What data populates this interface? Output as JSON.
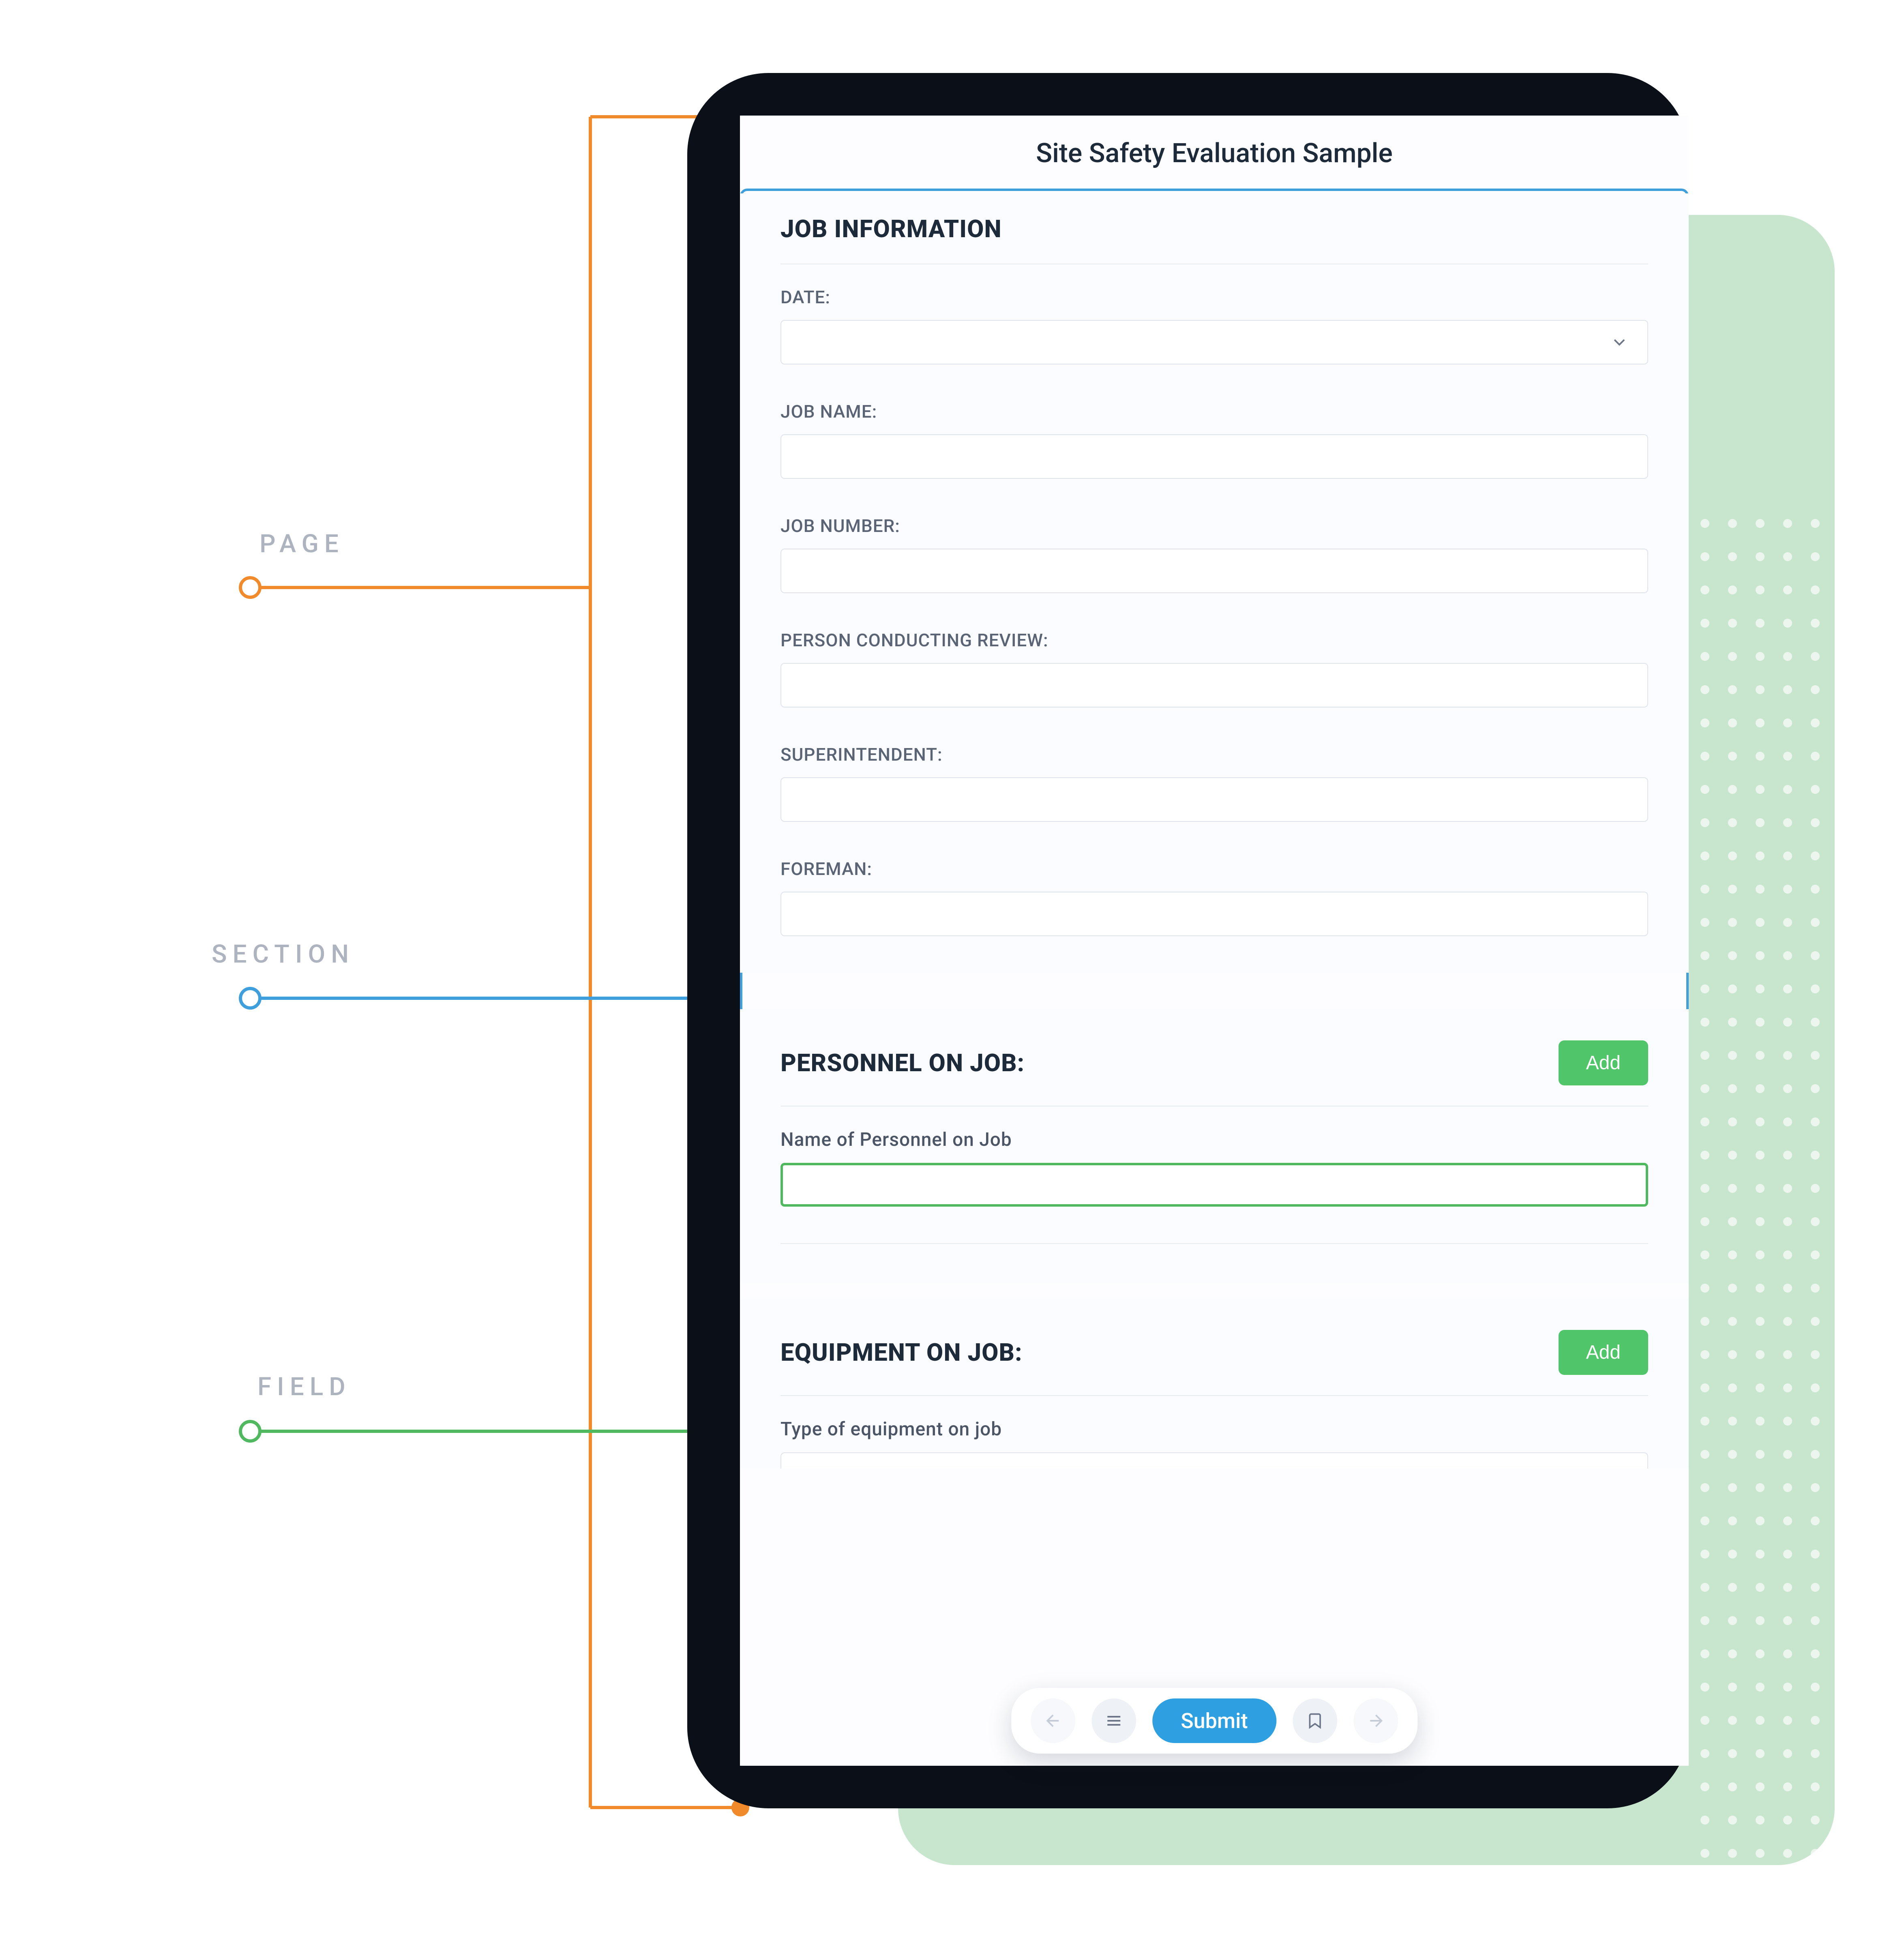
{
  "annotations": {
    "page_label": "PAGE",
    "section_label": "SECTION",
    "field_label": "FIELD"
  },
  "colors": {
    "page": "#f08a2b",
    "section": "#3e9fdc",
    "field": "#50b95f",
    "mint": "#c8e6cd",
    "submit": "#2e9fe0",
    "add": "#50c56a"
  },
  "form": {
    "title": "Site Safety Evaluation Sample",
    "sections": [
      {
        "title": "JOB INFORMATION",
        "fields": [
          {
            "label": "DATE:",
            "type": "select",
            "value": ""
          },
          {
            "label": "JOB NAME:",
            "type": "text",
            "value": ""
          },
          {
            "label": "JOB NUMBER:",
            "type": "text",
            "value": ""
          },
          {
            "label": "PERSON CONDUCTING REVIEW:",
            "type": "text",
            "value": ""
          },
          {
            "label": "SUPERINTENDENT:",
            "type": "text",
            "value": ""
          },
          {
            "label": "FOREMAN:",
            "type": "text",
            "value": ""
          }
        ]
      },
      {
        "title": "PERSONNEL ON JOB:",
        "add_label": "Add",
        "fields": [
          {
            "label": "Name of Personnel on Job",
            "type": "text",
            "value": "",
            "highlighted": true
          }
        ]
      },
      {
        "title": "EQUIPMENT ON JOB:",
        "add_label": "Add",
        "fields": [
          {
            "label": "Type of equipment on job",
            "type": "text",
            "value": ""
          }
        ]
      }
    ]
  },
  "toolbar": {
    "back": "back",
    "menu": "menu",
    "submit_label": "Submit",
    "bookmark": "bookmark",
    "forward": "forward"
  }
}
